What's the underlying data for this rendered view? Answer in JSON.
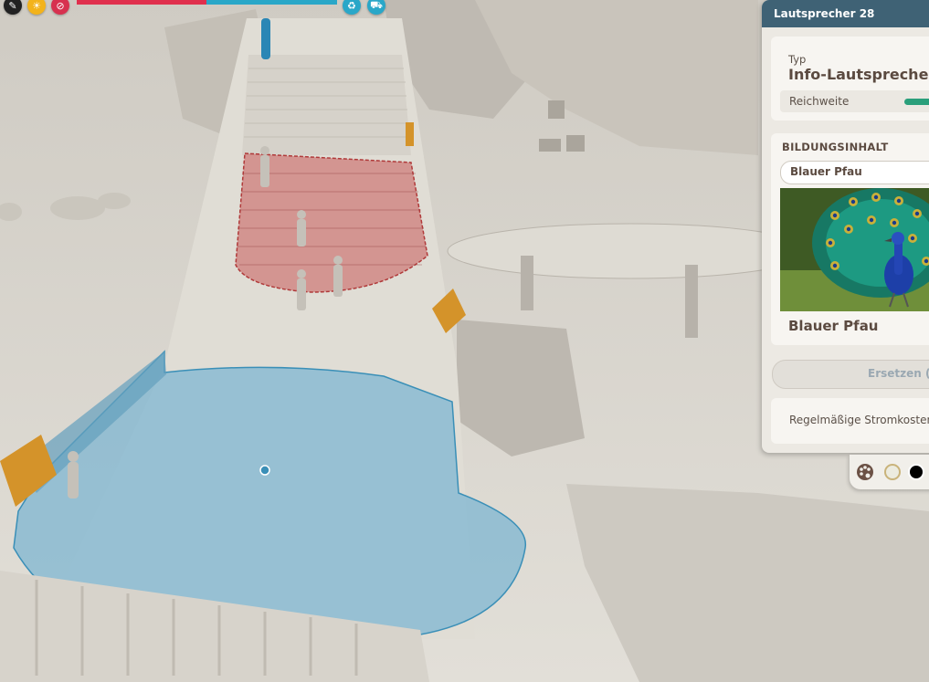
{
  "hud": {
    "icons": [
      "brush-icon",
      "sun-icon",
      "no-entry-icon",
      "ecology-icon",
      "cart-icon"
    ],
    "bar_colors": {
      "red": "#e0304d",
      "blue": "#2aa7c8"
    }
  },
  "panel": {
    "title": "Lautsprecher 28",
    "type_label": "Typ",
    "type_value": "Info-Lautsprecher",
    "range_label": "Reichweite",
    "section_title": "BILDUNGSINHALT",
    "selected_content": "Blauer Pfau",
    "image_caption": "Blauer Pfau",
    "replace_button": "Ersetzen ($",
    "cost_label": "Regelmäßige Stromkosten",
    "accent_color": "#3f6275"
  },
  "swatches": {
    "colors": [
      "#ecebdf",
      "#000000"
    ]
  }
}
